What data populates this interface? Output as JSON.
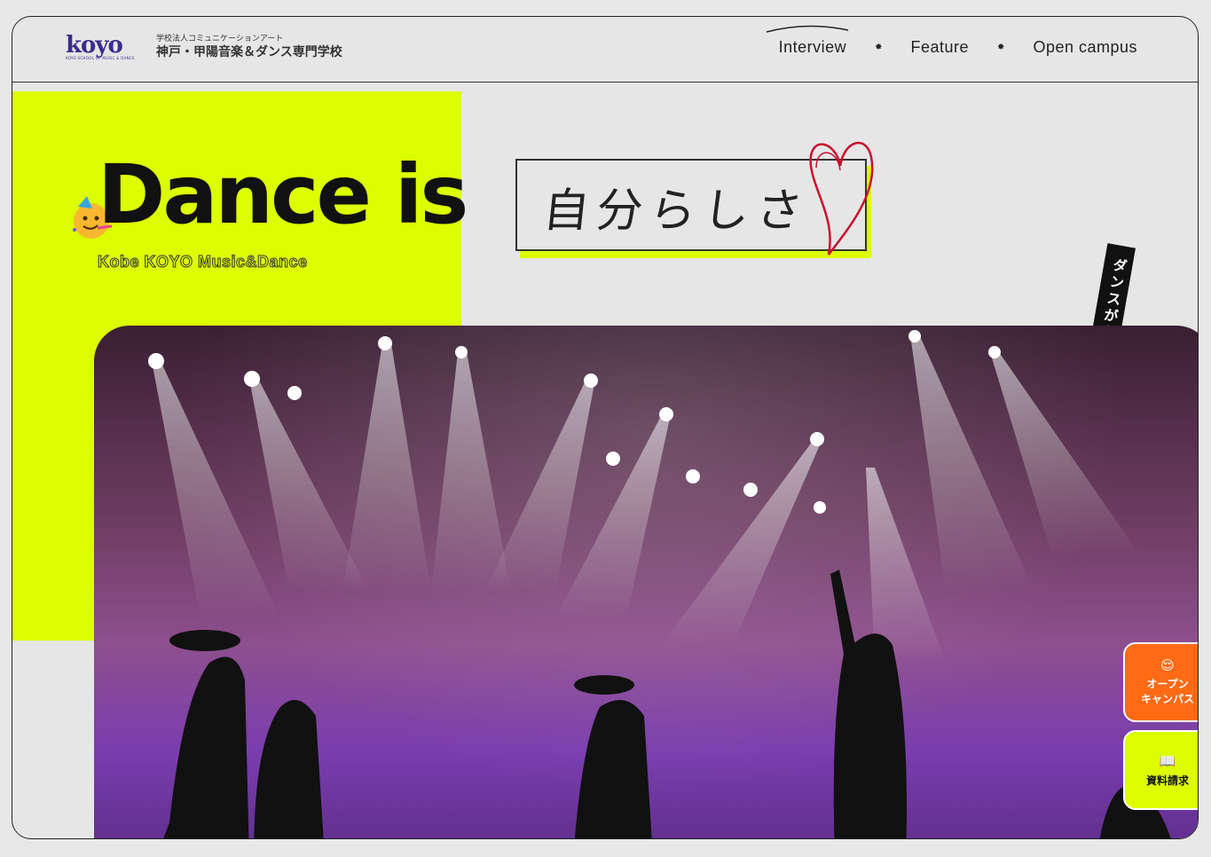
{
  "header": {
    "logo_word": "koyo",
    "logo_sub": "KOYO SCHOOL OF MUSIC & DANCE",
    "corp_name": "学校法人コミュニケーションアート",
    "school_name": "神戸・甲陽音楽＆ダンス専門学校"
  },
  "nav": {
    "items": [
      {
        "label": "Interview"
      },
      {
        "label": "Feature"
      },
      {
        "label": "Open campus"
      }
    ],
    "separator": "✸"
  },
  "hero": {
    "title": "Dance is",
    "subtitle": "Kobe KOYO Music&Dance",
    "handwritten": "自分らしさ",
    "vertical_tagline": "ダンスがあって、私がいる"
  },
  "side_buttons": {
    "open_campus": {
      "icon": "😌",
      "line1": "オープン",
      "line2": "キャンパス"
    },
    "brochure": {
      "icon": "📖",
      "label": "資料請求"
    }
  },
  "colors": {
    "accent": "#dcff00",
    "orange": "#ff6a13",
    "ink": "#111111",
    "heart": "#c8102e"
  }
}
